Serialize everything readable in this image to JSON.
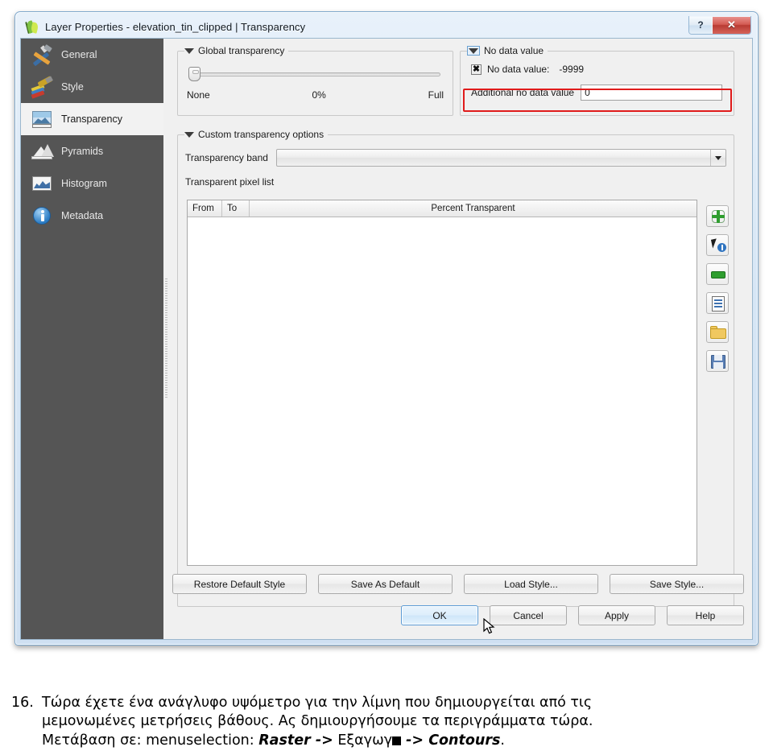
{
  "window": {
    "title": "Layer Properties - elevation_tin_clipped | Transparency",
    "icon": "qgis-leaf-icon",
    "help_button": "?",
    "close_button": "✕"
  },
  "sidebar": {
    "items": [
      {
        "label": "General",
        "icon": "tools-icon",
        "selected": false
      },
      {
        "label": "Style",
        "icon": "paintbrush-icon",
        "selected": false
      },
      {
        "label": "Transparency",
        "icon": "raster-image-icon",
        "selected": true
      },
      {
        "label": "Pyramids",
        "icon": "pyramids-icon",
        "selected": false
      },
      {
        "label": "Histogram",
        "icon": "histogram-icon",
        "selected": false
      },
      {
        "label": "Metadata",
        "icon": "info-circle-icon",
        "selected": false
      }
    ]
  },
  "global_transparency": {
    "title": "Global transparency",
    "slider_value": 0,
    "label_left": "None",
    "label_center": "0%",
    "label_right": "Full"
  },
  "no_data_value": {
    "title": "No data value",
    "checkbox_label": "No data value:",
    "checkbox_mark": "✖",
    "checkbox_checked": true,
    "value": "-9999",
    "additional_label": "Additional no data value",
    "additional_value": "0",
    "highlight_color": "#e01b1b"
  },
  "custom_transparency": {
    "title": "Custom transparency options",
    "band_label": "Transparency band",
    "band_value": "",
    "pixel_list_label": "Transparent pixel list",
    "columns": [
      "From",
      "To",
      "Percent Transparent"
    ],
    "rows": []
  },
  "tool_buttons": [
    {
      "name": "add-values-manually-button",
      "icon": "green-plus-icon"
    },
    {
      "name": "add-values-from-display-button",
      "icon": "pick-cursor-icon"
    },
    {
      "name": "remove-selected-row-button",
      "icon": "green-minus-icon"
    },
    {
      "name": "default-values-button",
      "icon": "list-icon"
    },
    {
      "name": "import-from-file-button",
      "icon": "open-folder-icon"
    },
    {
      "name": "export-to-file-button",
      "icon": "save-floppy-icon"
    }
  ],
  "style_buttons": [
    "Restore Default Style",
    "Save As Default",
    "Load Style...",
    "Save Style..."
  ],
  "dialog_buttons": [
    {
      "label": "OK",
      "default": true
    },
    {
      "label": "Cancel",
      "default": false
    },
    {
      "label": "Apply",
      "default": false
    },
    {
      "label": "Help",
      "default": false
    }
  ],
  "caption": {
    "number": "16.",
    "line1": "Τώρα έχετε ένα ανάγλυφο υψόμετρο για την λίμνη που δημιουργείται από τις",
    "line2": "μεμονωμένες μετρήσεις βάθους. Ας δημιουργήσουμε τα περιγράμματα τώρα.",
    "line3_prefix": "Μετάβαση σε: menuselection: ",
    "line3_raster": "Raster ->",
    "line3_greek": " Εξαγωγ",
    "line3_contours": " -> Contours",
    "line3_end": "."
  }
}
